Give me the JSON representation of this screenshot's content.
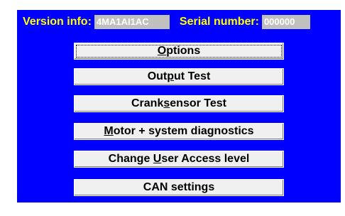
{
  "header": {
    "version_label": "Version info:",
    "version_value": "4MA1AI1AC",
    "serial_label": "Serial number:",
    "serial_value": "000000"
  },
  "buttons": [
    {
      "pre": "",
      "ul": "O",
      "post": "ptions"
    },
    {
      "pre": "Out",
      "ul": "p",
      "post": "ut Test"
    },
    {
      "pre": "Crank",
      "ul": "s",
      "post": "ensor Test"
    },
    {
      "pre": "",
      "ul": "M",
      "post": "otor + system diagnostics"
    },
    {
      "pre": "Change ",
      "ul": "U",
      "post": "ser Access level"
    },
    {
      "pre": "CAN settings",
      "ul": "",
      "post": ""
    }
  ],
  "colors": {
    "panel_bg": "#0000fe",
    "label_text": "#ffff00",
    "field_bg": "#c0c0c0",
    "button_bg": "#f0f0f0"
  }
}
